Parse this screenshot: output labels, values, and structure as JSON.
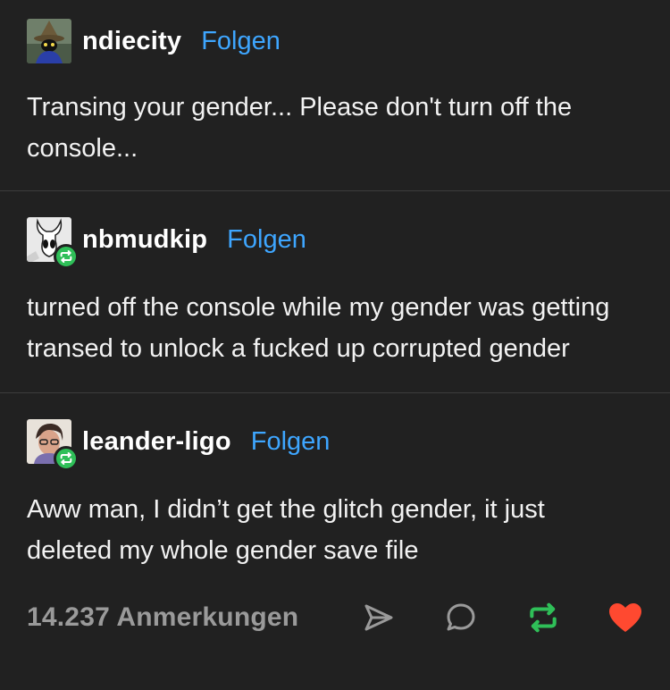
{
  "posts": [
    {
      "username": "ndiecity",
      "follow_label": "Folgen",
      "text": "Transing your gender... Please don't turn off the console...",
      "avatar_icon": "avatar-black-mage-icon",
      "reblogged": false
    },
    {
      "username": "nbmudkip",
      "follow_label": "Folgen",
      "text": "turned off the console while my gender was getting transed to unlock a fucked up corrupted gender",
      "avatar_icon": "avatar-hollow-knight-icon",
      "reblogged": true
    },
    {
      "username": "leander-ligo",
      "follow_label": "Folgen",
      "text": "Aww man, I didn’t get the glitch gender, it just deleted my whole gender save file",
      "avatar_icon": "avatar-drawn-portrait-icon",
      "reblogged": true
    }
  ],
  "footer": {
    "notes": "14.237 Anmerkungen",
    "icons": [
      "share-icon",
      "comment-icon",
      "reblog-icon",
      "like-heart-icon"
    ]
  },
  "colors": {
    "background": "#212121",
    "follow": "#3ea6ff",
    "reblog": "#2fbf58",
    "like": "#ff4930",
    "muted": "#9a9a9a"
  }
}
